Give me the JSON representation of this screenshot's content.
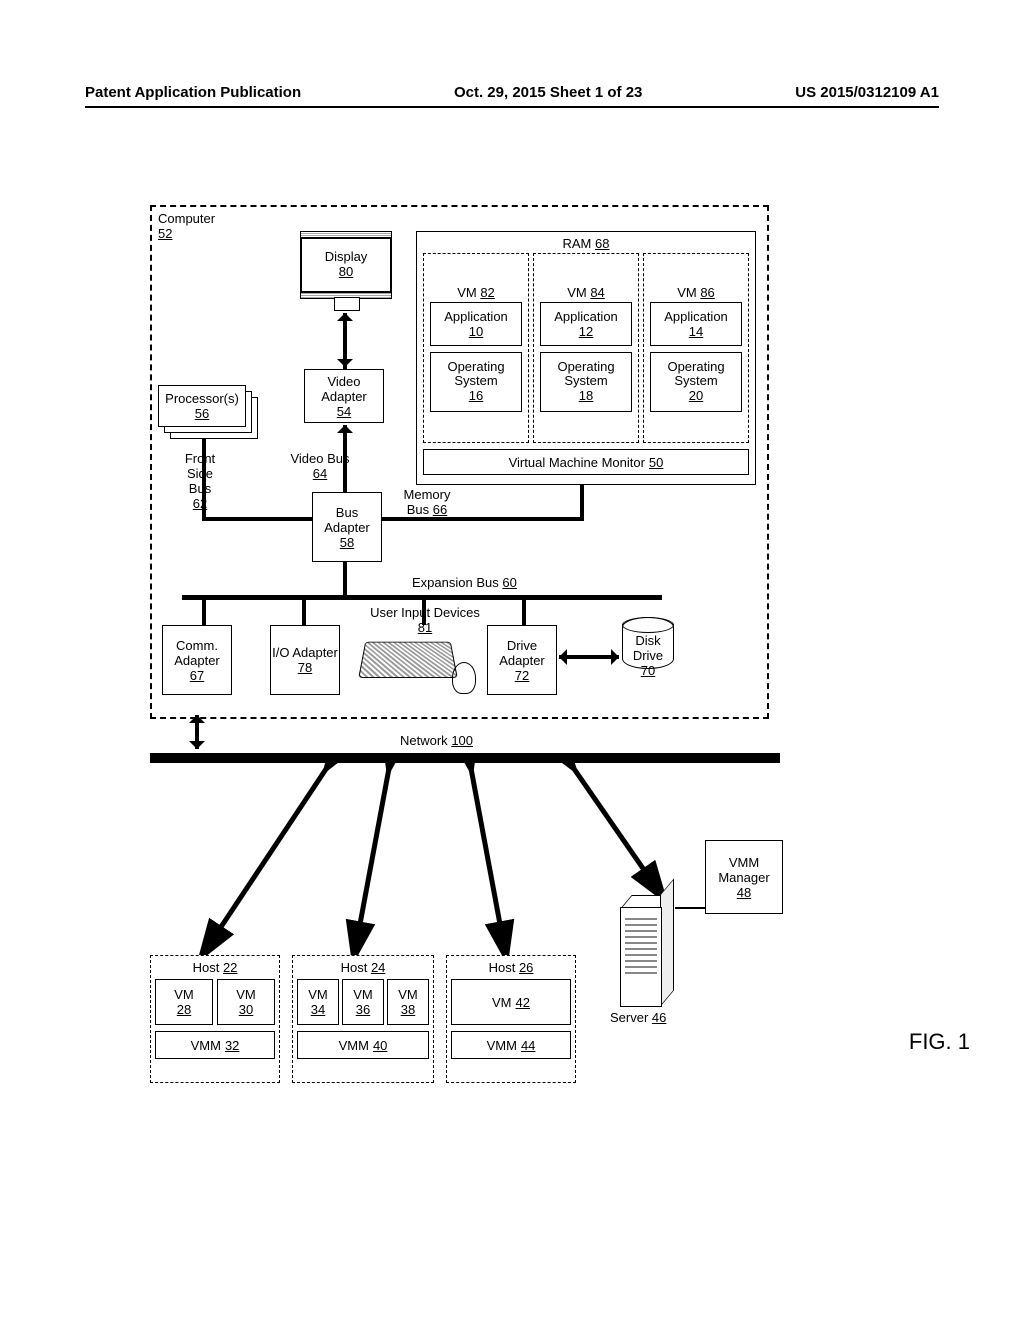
{
  "header": {
    "left": "Patent Application Publication",
    "center": "Oct. 29, 2015  Sheet 1 of 23",
    "right": "US 2015/0312109 A1"
  },
  "figure_label": "FIG. 1",
  "computer": {
    "title": "Computer",
    "num": "52"
  },
  "display": {
    "title": "Display",
    "num": "80"
  },
  "ram": {
    "title": "RAM",
    "num": "68",
    "vms": [
      {
        "title": "VM",
        "num": "82",
        "app_title": "Application",
        "app_num": "10",
        "os_title": "Operating System",
        "os_num": "16"
      },
      {
        "title": "VM",
        "num": "84",
        "app_title": "Application",
        "app_num": "12",
        "os_title": "Operating System",
        "os_num": "18"
      },
      {
        "title": "VM",
        "num": "86",
        "app_title": "Application",
        "app_num": "14",
        "os_title": "Operating System",
        "os_num": "20"
      }
    ],
    "vmm_title": "Virtual Machine Monitor",
    "vmm_num": "50"
  },
  "video_adapter": {
    "title": "Video Adapter",
    "num": "54"
  },
  "processors": {
    "title": "Processor(s)",
    "num": "56"
  },
  "fsb": {
    "title": "Front Side Bus",
    "num": "62"
  },
  "video_bus": {
    "title": "Video Bus",
    "num": "64"
  },
  "bus_adapter": {
    "title": "Bus Adapter",
    "num": "58"
  },
  "memory_bus": {
    "title": "Memory Bus",
    "num": "66"
  },
  "exp_bus": {
    "title": "Expansion Bus",
    "num": "60"
  },
  "user_input": {
    "title": "User Input Devices",
    "num": "81"
  },
  "comm": {
    "title": "Comm. Adapter",
    "num": "67"
  },
  "io": {
    "title": "I/O Adapter",
    "num": "78"
  },
  "drive_adapter": {
    "title": "Drive Adapter",
    "num": "72"
  },
  "disk": {
    "title": "Disk Drive",
    "num": "70"
  },
  "network": {
    "title": "Network",
    "num": "100"
  },
  "hosts": [
    {
      "title": "Host",
      "num": "22",
      "vms": [
        {
          "t": "VM",
          "n": "28"
        },
        {
          "t": "VM",
          "n": "30"
        }
      ],
      "vmm_t": "VMM",
      "vmm_n": "32"
    },
    {
      "title": "Host",
      "num": "24",
      "vms": [
        {
          "t": "VM",
          "n": "34"
        },
        {
          "t": "VM",
          "n": "36"
        },
        {
          "t": "VM",
          "n": "38"
        }
      ],
      "vmm_t": "VMM",
      "vmm_n": "40"
    },
    {
      "title": "Host",
      "num": "26",
      "vms": [
        {
          "t": "VM",
          "n": "42"
        }
      ],
      "vmm_t": "VMM",
      "vmm_n": "44"
    }
  ],
  "server": {
    "title": "Server",
    "num": "46"
  },
  "vmm_mgr": {
    "title": "VMM Manager",
    "num": "48"
  }
}
